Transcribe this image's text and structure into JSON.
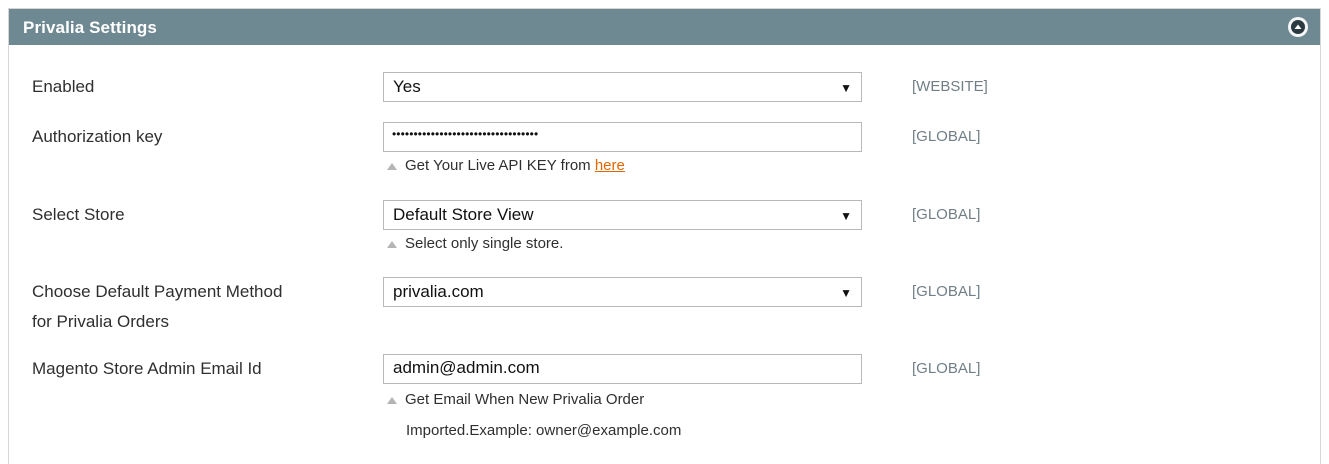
{
  "panel": {
    "title": "Privalia Settings",
    "collapse_icon": "collapse-up-icon"
  },
  "rows": {
    "enabled": {
      "label": "Enabled",
      "value": "Yes",
      "scope": "[WEBSITE]"
    },
    "auth_key": {
      "label": "Authorization key",
      "value": "••••••••••••••••••••••••••••••••••",
      "scope": "[GLOBAL]",
      "note_text": "Get Your Live API KEY from ",
      "note_link": "here"
    },
    "store": {
      "label": "Select Store",
      "value": "Default Store View",
      "scope": "[GLOBAL]",
      "note_text": "Select only single store."
    },
    "payment": {
      "label_line1": "Choose Default Payment Method",
      "label_line2": "for Privalia Orders",
      "value": "privalia.com",
      "scope": "[GLOBAL]"
    },
    "email": {
      "label": "Magento Store Admin Email Id",
      "value": "admin@admin.com",
      "scope": "[GLOBAL]",
      "note_line1": "Get Email When New Privalia Order",
      "note_line2": "Imported.Example: owner@example.com"
    }
  },
  "colors": {
    "header_bg": "#6f8992",
    "link": "#e26703",
    "scope_text": "#707f86"
  }
}
